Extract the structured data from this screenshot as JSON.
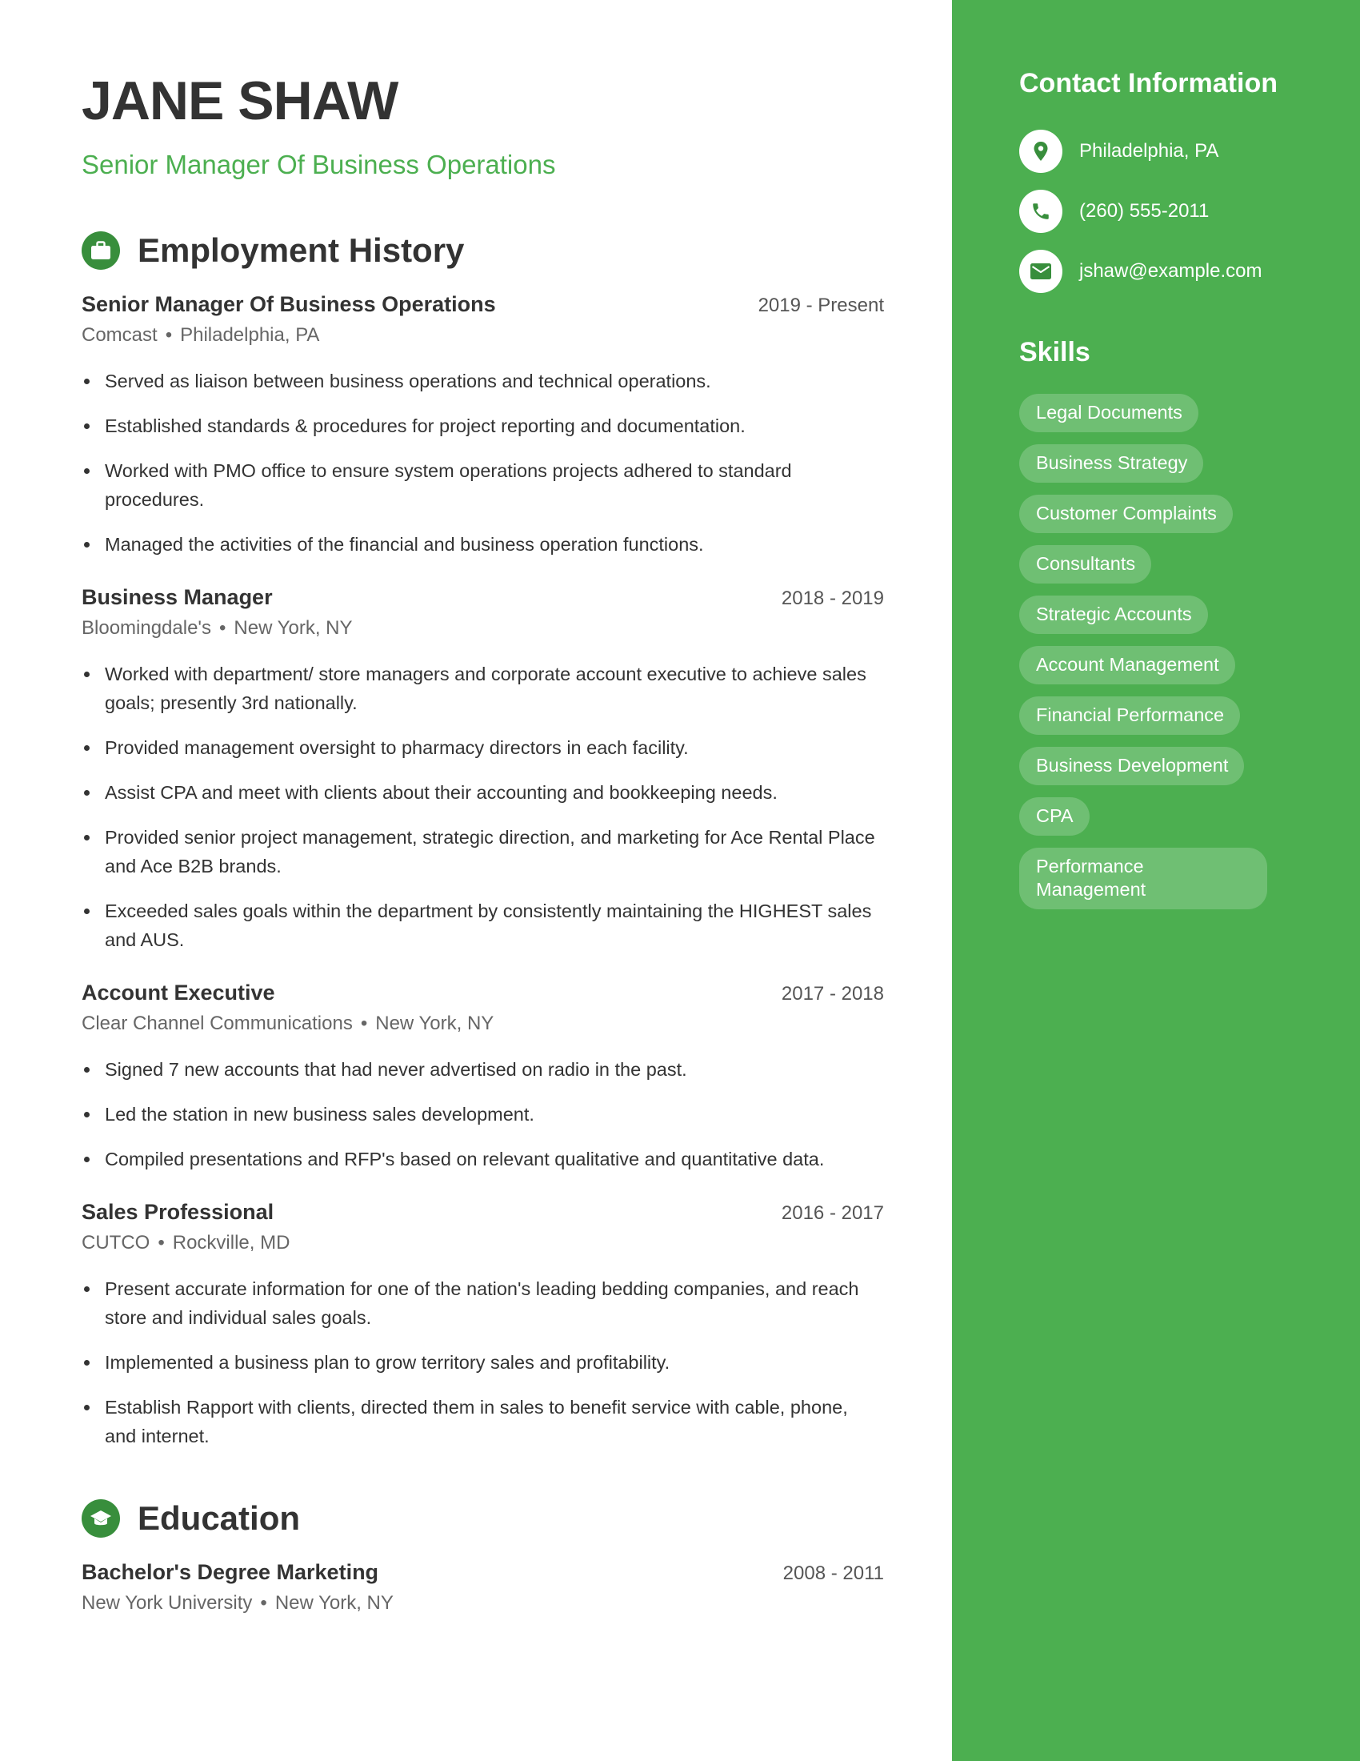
{
  "header": {
    "name": "JANE SHAW",
    "headline": "Senior Manager Of Business Operations"
  },
  "employment": {
    "title": "Employment History",
    "icon": "briefcase-icon",
    "entries": [
      {
        "title": "Senior Manager Of Business Operations",
        "date": "2019 - Present",
        "company": "Comcast",
        "location": "Philadelphia, PA",
        "bullets": [
          "Served as liaison between business operations and technical operations.",
          "Established standards & procedures for project reporting and documentation.",
          "Worked with PMO office to ensure system operations projects adhered to standard procedures.",
          "Managed the activities of the financial and business operation functions."
        ]
      },
      {
        "title": "Business Manager",
        "date": "2018 - 2019",
        "company": "Bloomingdale's",
        "location": "New York, NY",
        "bullets": [
          "Worked with department/ store managers and corporate account executive to achieve sales goals; presently 3rd nationally.",
          "Provided management oversight to pharmacy directors in each facility.",
          "Assist CPA and meet with clients about their accounting and bookkeeping needs.",
          "Provided senior project management, strategic direction, and marketing for Ace Rental Place and Ace B2B brands.",
          "Exceeded sales goals within the department by consistently maintaining the HIGHEST sales and AUS."
        ]
      },
      {
        "title": "Account Executive",
        "date": "2017 - 2018",
        "company": "Clear Channel Communications",
        "location": "New York, NY",
        "bullets": [
          "Signed 7 new accounts that had never advertised on radio in the past.",
          "Led the station in new business sales development.",
          "Compiled presentations and RFP's based on relevant qualitative and quantitative data."
        ]
      },
      {
        "title": "Sales Professional",
        "date": "2016 - 2017",
        "company": "CUTCO",
        "location": "Rockville, MD",
        "bullets": [
          "Present accurate information for one of the nation's leading bedding companies, and reach store and individual sales goals.",
          "Implemented a business plan to grow territory sales and profitability.",
          "Establish Rapport with clients, directed them in sales to benefit service with cable, phone, and internet."
        ]
      }
    ]
  },
  "education": {
    "title": "Education",
    "icon": "graduation-cap-icon",
    "entries": [
      {
        "title": "Bachelor's Degree Marketing",
        "date": "2008 - 2011",
        "school": "New York University",
        "location": "New York, NY"
      }
    ]
  },
  "separator": "•",
  "contact": {
    "title": "Contact Information",
    "items": [
      {
        "icon": "location-pin-icon",
        "text": "Philadelphia, PA"
      },
      {
        "icon": "phone-icon",
        "text": "(260) 555-2011"
      },
      {
        "icon": "email-icon",
        "text": "jshaw@example.com"
      }
    ]
  },
  "skills": {
    "title": "Skills",
    "items": [
      "Legal Documents",
      "Business Strategy",
      "Customer Complaints",
      "Consultants",
      "Strategic Accounts",
      "Account Management",
      "Financial Performance",
      "Business Development",
      "CPA",
      "Performance Management"
    ]
  },
  "colors": {
    "accent": "#4CAF50",
    "accent_dark": "#388E3C",
    "text": "#333333",
    "muted": "#666666"
  }
}
